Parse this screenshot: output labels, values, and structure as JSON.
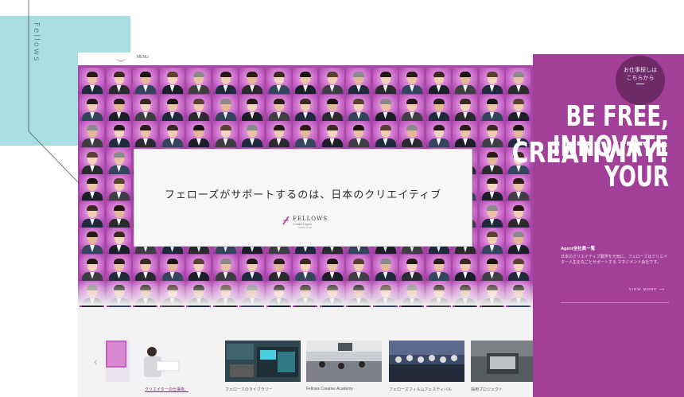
{
  "brand_vertical": "Fellows",
  "site": {
    "header_menu": "MENU",
    "hero_text": "フェローズがサポートするのは、日本のクリエイティブ",
    "logo_name": "FELLOWS",
    "logo_sub": "Creator's Agent",
    "logo_sub2": "SINCE 2000"
  },
  "carousel": {
    "prev_icon": "chevron-left-icon",
    "next_icon": "chevron-right-icon",
    "items": [
      {
        "caption": "クリエイターの仕事術。"
      },
      {
        "caption": "フェローズのライブラリー"
      },
      {
        "caption": "Fellows Creative Academy"
      },
      {
        "caption": "フェローズフィルムフェスティバル"
      },
      {
        "caption": "採用プロジェクト"
      }
    ]
  },
  "panel": {
    "circle_line1": "お仕事探しは",
    "circle_line2": "こちらから",
    "slogan_line1": "BE FREE,",
    "slogan_line2": "INNOVATE",
    "slogan_line3": "YOUR",
    "slogan_line4": "CREATIVITY!",
    "agent_title": "Agent全社員一覧",
    "agent_desc": "日本のクリエイティブ業界を元気に。フェローズはクリエイター人生を丸ごとサポートする マネジメント会社です。",
    "view_more": "VIEW MORE  ⟶"
  },
  "colors": {
    "panel": "#a13f99",
    "teal": "#a9dde3",
    "accent": "#7a2f77"
  }
}
